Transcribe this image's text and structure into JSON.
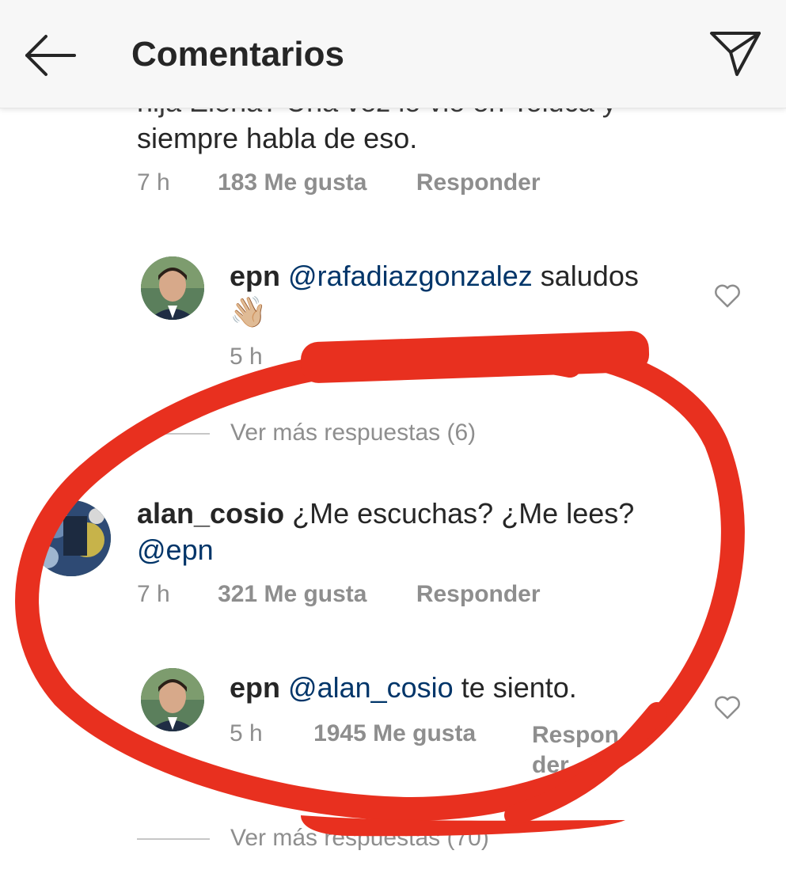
{
  "header": {
    "title": "Comentarios",
    "back_icon": "arrow-left-icon",
    "share_icon": "paper-plane-icon"
  },
  "comments": [
    {
      "text_line2": "siempre habla de eso.",
      "time": "7 h",
      "likes": "183 Me gusta",
      "reply": "Responder"
    },
    {
      "user": "epn",
      "mention": "@rafadiazgonzalez",
      "text": " saludos",
      "emoji": "👋🏼",
      "time": "5 h",
      "likes": "",
      "reply": ""
    },
    {
      "user": "alan_cosio",
      "text": " ¿Me escuchas? ¿Me lees?",
      "mention": "@epn",
      "time": "7 h",
      "likes": "321 Me gusta",
      "reply": "Responder"
    },
    {
      "user": "epn",
      "mention": "@alan_cosio",
      "text": " te siento.",
      "time": "5 h",
      "likes": "1945 Me gusta",
      "reply_line1": "Respon",
      "reply_line2": "der"
    }
  ],
  "view_more": [
    "Ver más respuestas (6)",
    "Ver más respuestas (70)"
  ],
  "colors": {
    "mention": "#003569",
    "secondary_text": "#8e8e8e",
    "annotation_red": "#e8301f"
  }
}
